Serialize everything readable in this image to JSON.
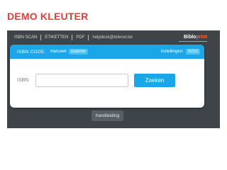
{
  "page": {
    "title": "DEMO KLEUTER"
  },
  "topnav": {
    "items": [
      "ISBN SCAN",
      "ETIKETTEN",
      "PDF"
    ],
    "email": "helpdesk@telenet.be"
  },
  "logo": {
    "text_main": "Biblo",
    "text_accent": "print"
  },
  "card": {
    "header": {
      "isbn_code_label": "ISBN CODE:",
      "mode_label": "manueel",
      "mode_value": "scanner",
      "settings_label": "instellingen:",
      "settings_value": "SISO"
    },
    "isbn": {
      "label": "ISBN",
      "value": "",
      "placeholder": ""
    },
    "search_button": "Zoeken"
  },
  "help_button": "handleiding",
  "colors": {
    "accent_blue": "#1aa7e8",
    "title_red": "#e53b3b",
    "app_bg": "#3f4448"
  }
}
